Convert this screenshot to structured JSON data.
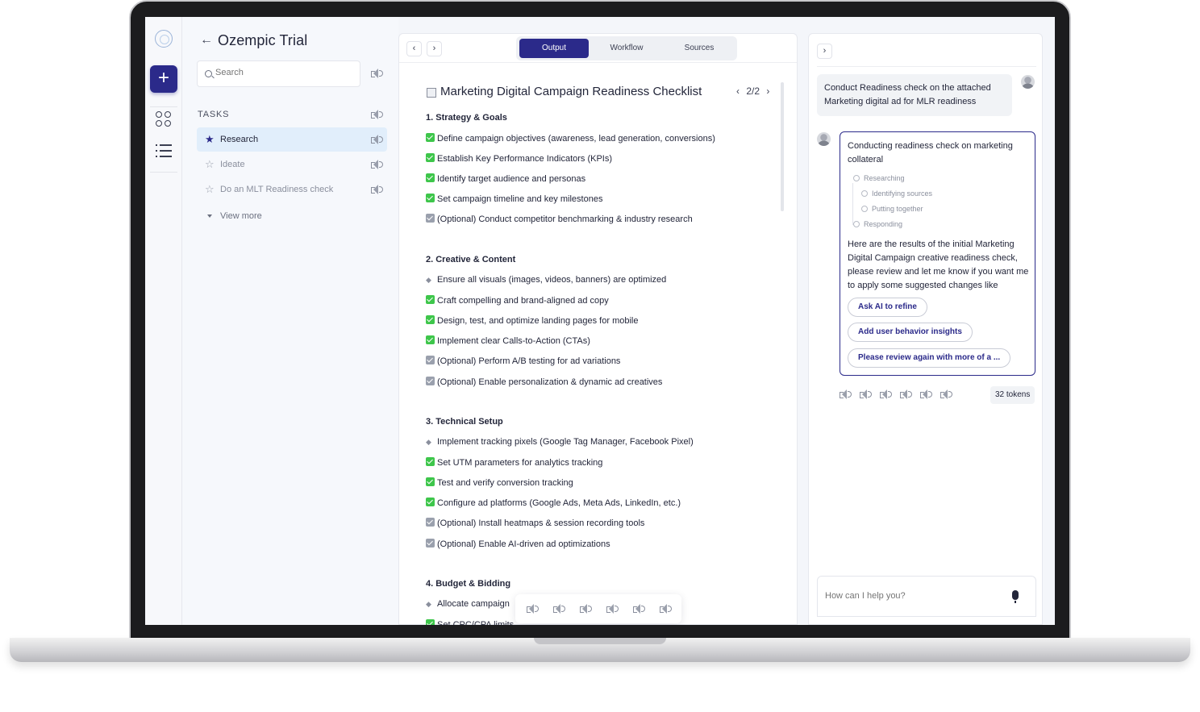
{
  "project": {
    "title": "Ozempic Trial"
  },
  "search": {
    "placeholder": "Search"
  },
  "tasks": {
    "label": "TASKS",
    "items": [
      {
        "label": "Research",
        "active": true
      },
      {
        "label": "Ideate",
        "active": false
      },
      {
        "label": "Do an MLT Readiness check",
        "active": false
      }
    ],
    "view_more": "View more"
  },
  "center": {
    "tabs": [
      "Output",
      "Workflow",
      "Sources"
    ],
    "active_tab": "Output",
    "nav_prev": "‹",
    "nav_next": "›",
    "doc_title": "Marketing Digital Campaign Readiness Checklist",
    "pager": "2/2",
    "sections": [
      {
        "heading": "1. Strategy & Goals",
        "items": [
          {
            "text": "Define campaign objectives (awareness, lead generation, conversions)",
            "mark": "green"
          },
          {
            "text": "Establish Key Performance Indicators (KPIs)",
            "mark": "green"
          },
          {
            "text": "Identify target audience and personas",
            "mark": "green"
          },
          {
            "text": "Set campaign timeline and key milestones",
            "mark": "green"
          },
          {
            "text": "(Optional) Conduct competitor benchmarking & industry research",
            "mark": "gray"
          }
        ]
      },
      {
        "heading": "2. Creative & Content",
        "items": [
          {
            "text": "Ensure all visuals (images, videos, banners) are optimized",
            "mark": "icon"
          },
          {
            "text": "Craft compelling and brand-aligned ad copy",
            "mark": "green"
          },
          {
            "text": "Design, test, and optimize landing pages for mobile",
            "mark": "green"
          },
          {
            "text": "Implement clear Calls-to-Action (CTAs)",
            "mark": "green"
          },
          {
            "text": "(Optional) Perform A/B testing for ad variations",
            "mark": "gray"
          },
          {
            "text": "(Optional) Enable personalization & dynamic ad creatives",
            "mark": "gray"
          }
        ]
      },
      {
        "heading": "3.  Technical Setup",
        "items": [
          {
            "text": "Implement tracking pixels (Google Tag Manager, Facebook Pixel)",
            "mark": "icon"
          },
          {
            "text": "Set UTM parameters for analytics tracking",
            "mark": "green"
          },
          {
            "text": "Test and verify conversion tracking",
            "mark": "green"
          },
          {
            "text": "Configure ad platforms (Google Ads, Meta Ads, LinkedIn, etc.)",
            "mark": "green"
          },
          {
            "text": "(Optional) Install heatmaps & session recording tools",
            "mark": "gray"
          },
          {
            "text": "(Optional) Enable AI-driven ad optimizations",
            "mark": "gray"
          }
        ]
      },
      {
        "heading": "4.  Budget & Bidding",
        "items": [
          {
            "text": "Allocate campaign",
            "mark": "icon"
          },
          {
            "text": "Set CPC/CPA limits",
            "mark": "green"
          }
        ]
      }
    ]
  },
  "chat": {
    "collapse": "›",
    "user_message": "Conduct Readiness check on the attached Marketing digital ad for MLR readiness",
    "ai_intro": "Conducting readiness check on marketing collateral",
    "steps": [
      "Researching",
      "Identifying sources",
      "Putting together",
      "Responding"
    ],
    "ai_result": "Here are the results of the initial Marketing Digital Campaign creative readiness check, please review and let me know if you want me to apply some suggested changes like",
    "chips": [
      "Ask AI to refine",
      "Add user behavior insights",
      "Please review again with more of a ..."
    ],
    "tokens": "32 tokens",
    "input_placeholder": "How can I help you?"
  },
  "colors": {
    "accent": "#2b2a8a",
    "check_green": "#3ec64b",
    "active_task_bg": "#e1eefb"
  }
}
